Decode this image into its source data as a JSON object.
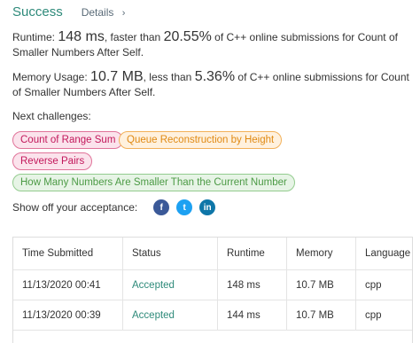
{
  "header": {
    "status": "Success",
    "details_label": "Details",
    "details_chevron": "›"
  },
  "runtime": {
    "label": "Runtime:",
    "value": "148 ms",
    "connector": ", faster than",
    "percent": "20.55%",
    "suffix": "of C++ online submissions for Count of Smaller Numbers After Self."
  },
  "memory": {
    "label": "Memory Usage:",
    "value": "10.7 MB",
    "connector": ", less than",
    "percent": "5.36%",
    "suffix": "of C++ online submissions for Count of Smaller Numbers After Self."
  },
  "next": {
    "title": "Next challenges:",
    "items": [
      "Count of Range Sum",
      "Queue Reconstruction by Height",
      "Reverse Pairs",
      "How Many Numbers Are Smaller Than the Current Number"
    ]
  },
  "share": {
    "label": "Show off your acceptance:",
    "icons": [
      "facebook-icon",
      "twitter-icon",
      "linkedin-icon"
    ],
    "glyphs": [
      "f",
      "t",
      "in"
    ]
  },
  "table": {
    "headers": [
      "Time Submitted",
      "Status",
      "Runtime",
      "Memory",
      "Language"
    ],
    "rows": [
      [
        "11/13/2020 00:41",
        "Accepted",
        "148 ms",
        "10.7 MB",
        "cpp"
      ],
      [
        "11/13/2020 00:39",
        "Accepted",
        "144 ms",
        "10.7 MB",
        "cpp"
      ]
    ]
  },
  "colors": {
    "success": "#2e8a7a",
    "red_tag": "#c2185b",
    "orange_tag": "#e08a14",
    "green_tag": "#4c9a45"
  }
}
